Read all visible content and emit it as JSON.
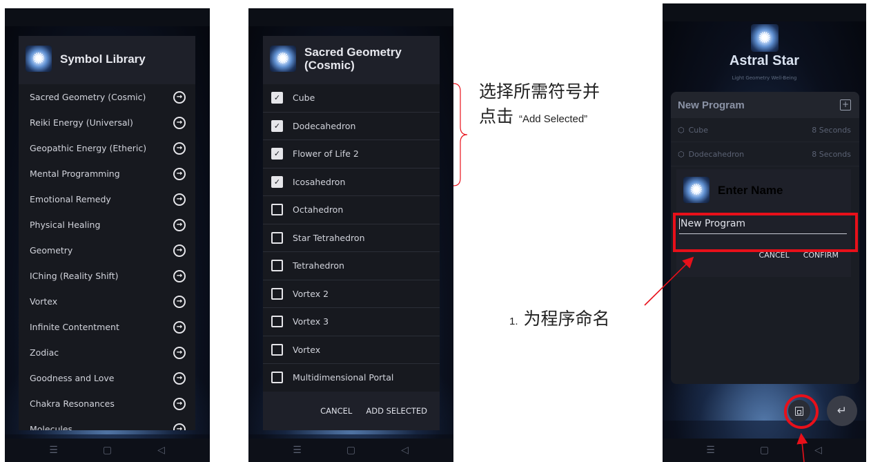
{
  "panel1": {
    "title": "Symbol Library",
    "items": [
      "Sacred Geometry (Cosmic)",
      "Reiki Energy (Universal)",
      "Geopathic Energy (Etheric)",
      "Mental Programming",
      "Emotional Remedy",
      "Physical Healing",
      "Geometry",
      "IChing (Reality Shift)",
      "Vortex",
      "Infinite Contentment",
      "Zodiac",
      "Goodness and Love",
      "Chakra Resonances",
      "Molecules"
    ],
    "arrow_icon": "arrow-right-circle-icon"
  },
  "panel2": {
    "title_line1": "Sacred Geometry",
    "title_line2": "(Cosmic)",
    "items": [
      {
        "label": "Cube",
        "checked": true
      },
      {
        "label": "Dodecahedron",
        "checked": true
      },
      {
        "label": "Flower of Life 2",
        "checked": true
      },
      {
        "label": "Icosahedron",
        "checked": true
      },
      {
        "label": "Octahedron",
        "checked": false
      },
      {
        "label": "Star Tetrahedron",
        "checked": false
      },
      {
        "label": "Tetrahedron",
        "checked": false
      },
      {
        "label": "Vortex 2",
        "checked": false
      },
      {
        "label": "Vortex 3",
        "checked": false
      },
      {
        "label": "Vortex",
        "checked": false
      },
      {
        "label": "Multidimensional Portal",
        "checked": false
      }
    ],
    "cancel": "CANCEL",
    "add_selected": "ADD SELECTED"
  },
  "annotation_select": {
    "line1": "选择所需符号并",
    "line2_prefix": "点击 ",
    "line2_quote": "“Add Selected”"
  },
  "panel3": {
    "brand_title": "Astral Star",
    "brand_subtitle": "Light Geometry Well-Being",
    "program_title": "New Program",
    "program_items": [
      {
        "label": "Cube",
        "duration": "8 Seconds"
      },
      {
        "label": "Dodecahedron",
        "duration": "8 Seconds"
      }
    ],
    "dialog_title": "Enter Name",
    "name_value": "New Program",
    "cancel": "CANCEL",
    "confirm": "CONFIRM"
  },
  "annotation_name": {
    "number": "1.",
    "text": "为程序命名"
  },
  "colors": {
    "highlight_red": "#e8101a",
    "dialog_bg": "#1e2029",
    "list_bg": "#17191f"
  },
  "nav": {
    "menu": "☰",
    "home": "▢",
    "back": "◁"
  }
}
